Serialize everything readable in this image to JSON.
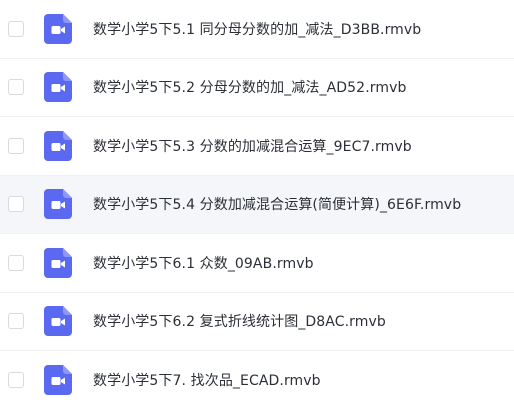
{
  "files": [
    {
      "name": "数学小学5下5.1 同分母分数的加_减法_D3BB.rmvb",
      "icon": "video-file-icon"
    },
    {
      "name": "数学小学5下5.2 分母分数的加_减法_AD52.rmvb",
      "icon": "video-file-icon"
    },
    {
      "name": "数学小学5下5.3 分数的加减混合运算_9EC7.rmvb",
      "icon": "video-file-icon"
    },
    {
      "name": "数学小学5下5.4 分数加减混合运算(简便计算)_6E6F.rmvb",
      "icon": "video-file-icon"
    },
    {
      "name": "数学小学5下6.1 众数_09AB.rmvb",
      "icon": "video-file-icon"
    },
    {
      "name": "数学小学5下6.2 复式折线统计图_D8AC.rmvb",
      "icon": "video-file-icon"
    },
    {
      "name": "数学小学5下7. 找次品_ECAD.rmvb",
      "icon": "video-file-icon"
    }
  ],
  "colors": {
    "icon_bg": "#5b68f0",
    "icon_fg": "#ffffff",
    "hover_row": "#f5f6fa",
    "text": "#2b2f36"
  }
}
